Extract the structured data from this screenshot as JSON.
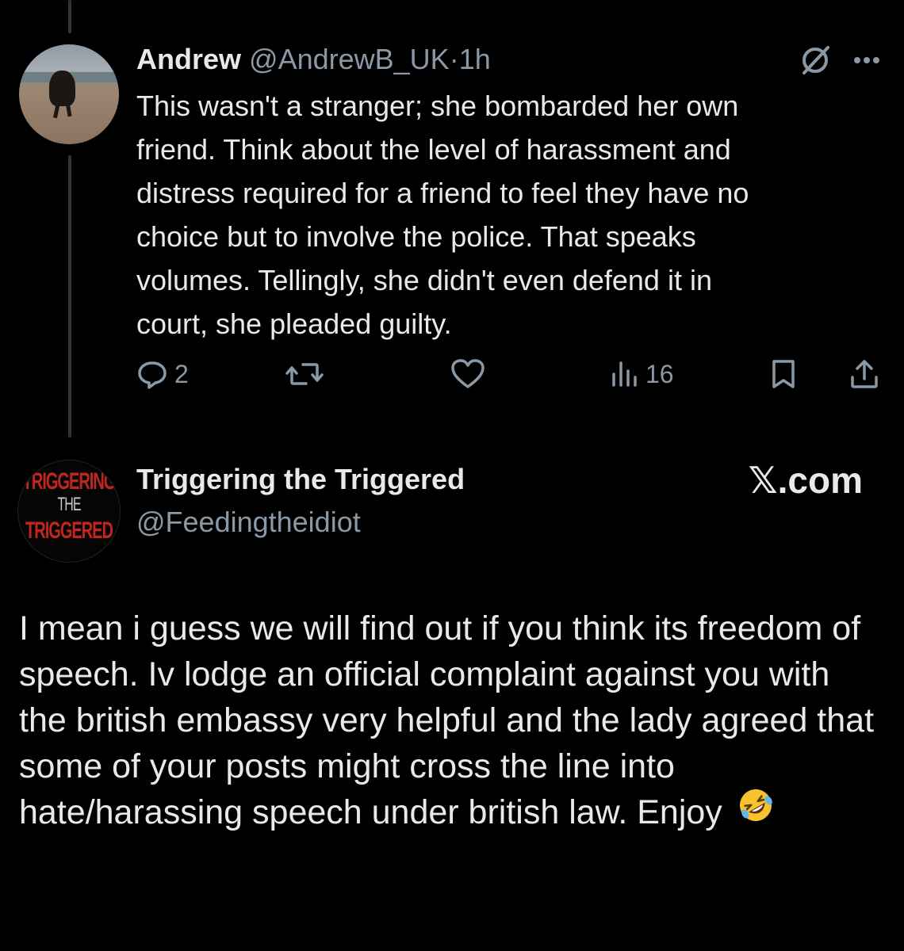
{
  "reply_tweet": {
    "author_name": "Andrew",
    "author_handle": "@AndrewB_UK",
    "separator": "·",
    "timestamp": "1h",
    "avatar_icon": "dog-on-beach-avatar",
    "text": "This wasn't a stranger; she bombarded her own\nfriend. Think about the level of harassment and\ndistress required for a friend to feel they have no\nchoice but to involve the police. That speaks\nvolumes. Tellingly, she didn't even defend it in\ncourt, she pleaded guilty.",
    "actions": {
      "reply_count": "2",
      "repost_count": "",
      "like_count": "",
      "views_count": "16"
    }
  },
  "dm_message": {
    "sender_name": "Triggering the Triggered",
    "sender_handle": "@Feedingtheidiot",
    "avatar_logo_lines": [
      "TRIGGERING",
      "THE",
      "TRIGGERED"
    ],
    "site_label": "𝕏.com",
    "text": "I mean i guess we will find out if you think its freedom of speech. Iv lodge an official complaint against you with the british embassy very helpful and the lady agreed that some of your posts might cross the line into hate/harassing speech under british law. Enjoy",
    "emoji": "rolling-on-floor-laughing-emoji"
  },
  "colors": {
    "background": "#000000",
    "text_primary": "#e7e9ea",
    "text_secondary": "#8b98a5",
    "logo_red": "#c0261e"
  }
}
